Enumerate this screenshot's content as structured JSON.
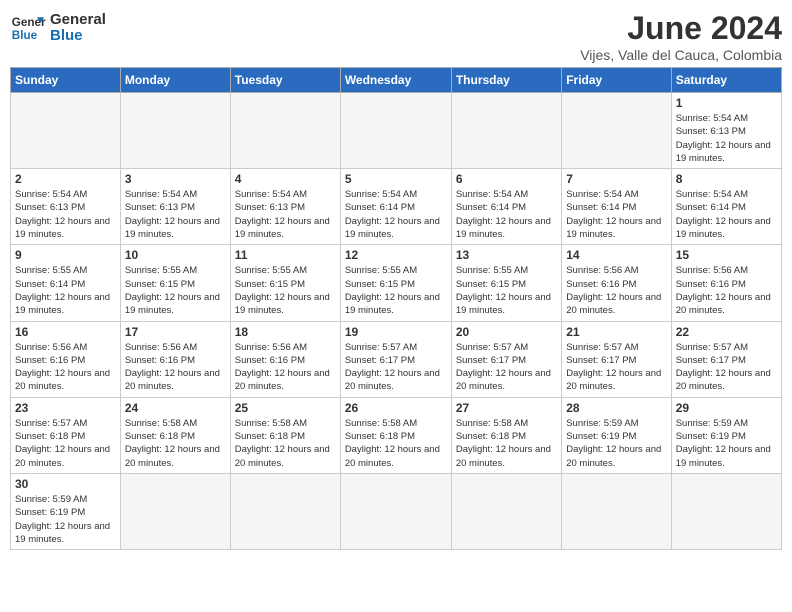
{
  "logo": {
    "line1": "General",
    "line2": "Blue"
  },
  "title": "June 2024",
  "subtitle": "Vijes, Valle del Cauca, Colombia",
  "weekdays": [
    "Sunday",
    "Monday",
    "Tuesday",
    "Wednesday",
    "Thursday",
    "Friday",
    "Saturday"
  ],
  "weeks": [
    [
      {
        "day": "",
        "info": ""
      },
      {
        "day": "",
        "info": ""
      },
      {
        "day": "",
        "info": ""
      },
      {
        "day": "",
        "info": ""
      },
      {
        "day": "",
        "info": ""
      },
      {
        "day": "",
        "info": ""
      },
      {
        "day": "1",
        "info": "Sunrise: 5:54 AM\nSunset: 6:13 PM\nDaylight: 12 hours and 19 minutes."
      }
    ],
    [
      {
        "day": "2",
        "info": "Sunrise: 5:54 AM\nSunset: 6:13 PM\nDaylight: 12 hours and 19 minutes."
      },
      {
        "day": "3",
        "info": "Sunrise: 5:54 AM\nSunset: 6:13 PM\nDaylight: 12 hours and 19 minutes."
      },
      {
        "day": "4",
        "info": "Sunrise: 5:54 AM\nSunset: 6:13 PM\nDaylight: 12 hours and 19 minutes."
      },
      {
        "day": "5",
        "info": "Sunrise: 5:54 AM\nSunset: 6:14 PM\nDaylight: 12 hours and 19 minutes."
      },
      {
        "day": "6",
        "info": "Sunrise: 5:54 AM\nSunset: 6:14 PM\nDaylight: 12 hours and 19 minutes."
      },
      {
        "day": "7",
        "info": "Sunrise: 5:54 AM\nSunset: 6:14 PM\nDaylight: 12 hours and 19 minutes."
      },
      {
        "day": "8",
        "info": "Sunrise: 5:54 AM\nSunset: 6:14 PM\nDaylight: 12 hours and 19 minutes."
      }
    ],
    [
      {
        "day": "9",
        "info": "Sunrise: 5:55 AM\nSunset: 6:14 PM\nDaylight: 12 hours and 19 minutes."
      },
      {
        "day": "10",
        "info": "Sunrise: 5:55 AM\nSunset: 6:15 PM\nDaylight: 12 hours and 19 minutes."
      },
      {
        "day": "11",
        "info": "Sunrise: 5:55 AM\nSunset: 6:15 PM\nDaylight: 12 hours and 19 minutes."
      },
      {
        "day": "12",
        "info": "Sunrise: 5:55 AM\nSunset: 6:15 PM\nDaylight: 12 hours and 19 minutes."
      },
      {
        "day": "13",
        "info": "Sunrise: 5:55 AM\nSunset: 6:15 PM\nDaylight: 12 hours and 19 minutes."
      },
      {
        "day": "14",
        "info": "Sunrise: 5:56 AM\nSunset: 6:16 PM\nDaylight: 12 hours and 20 minutes."
      },
      {
        "day": "15",
        "info": "Sunrise: 5:56 AM\nSunset: 6:16 PM\nDaylight: 12 hours and 20 minutes."
      }
    ],
    [
      {
        "day": "16",
        "info": "Sunrise: 5:56 AM\nSunset: 6:16 PM\nDaylight: 12 hours and 20 minutes."
      },
      {
        "day": "17",
        "info": "Sunrise: 5:56 AM\nSunset: 6:16 PM\nDaylight: 12 hours and 20 minutes."
      },
      {
        "day": "18",
        "info": "Sunrise: 5:56 AM\nSunset: 6:16 PM\nDaylight: 12 hours and 20 minutes."
      },
      {
        "day": "19",
        "info": "Sunrise: 5:57 AM\nSunset: 6:17 PM\nDaylight: 12 hours and 20 minutes."
      },
      {
        "day": "20",
        "info": "Sunrise: 5:57 AM\nSunset: 6:17 PM\nDaylight: 12 hours and 20 minutes."
      },
      {
        "day": "21",
        "info": "Sunrise: 5:57 AM\nSunset: 6:17 PM\nDaylight: 12 hours and 20 minutes."
      },
      {
        "day": "22",
        "info": "Sunrise: 5:57 AM\nSunset: 6:17 PM\nDaylight: 12 hours and 20 minutes."
      }
    ],
    [
      {
        "day": "23",
        "info": "Sunrise: 5:57 AM\nSunset: 6:18 PM\nDaylight: 12 hours and 20 minutes."
      },
      {
        "day": "24",
        "info": "Sunrise: 5:58 AM\nSunset: 6:18 PM\nDaylight: 12 hours and 20 minutes."
      },
      {
        "day": "25",
        "info": "Sunrise: 5:58 AM\nSunset: 6:18 PM\nDaylight: 12 hours and 20 minutes."
      },
      {
        "day": "26",
        "info": "Sunrise: 5:58 AM\nSunset: 6:18 PM\nDaylight: 12 hours and 20 minutes."
      },
      {
        "day": "27",
        "info": "Sunrise: 5:58 AM\nSunset: 6:18 PM\nDaylight: 12 hours and 20 minutes."
      },
      {
        "day": "28",
        "info": "Sunrise: 5:59 AM\nSunset: 6:19 PM\nDaylight: 12 hours and 20 minutes."
      },
      {
        "day": "29",
        "info": "Sunrise: 5:59 AM\nSunset: 6:19 PM\nDaylight: 12 hours and 19 minutes."
      }
    ],
    [
      {
        "day": "30",
        "info": "Sunrise: 5:59 AM\nSunset: 6:19 PM\nDaylight: 12 hours and 19 minutes."
      },
      {
        "day": "",
        "info": ""
      },
      {
        "day": "",
        "info": ""
      },
      {
        "day": "",
        "info": ""
      },
      {
        "day": "",
        "info": ""
      },
      {
        "day": "",
        "info": ""
      },
      {
        "day": "",
        "info": ""
      }
    ]
  ]
}
